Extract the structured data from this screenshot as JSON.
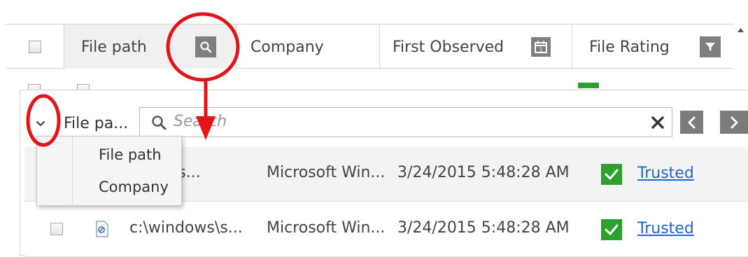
{
  "header": {
    "columns": [
      {
        "label": "File path"
      },
      {
        "label": "Company"
      },
      {
        "label": "First Observed"
      },
      {
        "label": "File Rating"
      }
    ]
  },
  "toolbar": {
    "column_select_value": "File pa...",
    "search_placeholder": "Search",
    "clear_icon": "close-icon",
    "prev_icon": "chevron-left-icon",
    "next_icon": "chevron-right-icon"
  },
  "dropdown": {
    "options": [
      "File path",
      "Company"
    ]
  },
  "rows": [
    {
      "path": "c:\\windows\\s...",
      "company": "Microsoft Win...",
      "date": "3/24/2015 5:48:28 AM",
      "rating": "Trusted"
    },
    {
      "path": "c:\\windows\\s...",
      "company": "Microsoft Win...",
      "date": "3/24/2015 5:48:28 AM",
      "rating": "Trusted"
    }
  ],
  "colors": {
    "annotation": "#e3151a",
    "trusted_badge": "#2ea02e",
    "link": "#2168c9",
    "icon_bg": "#7f7f7f"
  }
}
